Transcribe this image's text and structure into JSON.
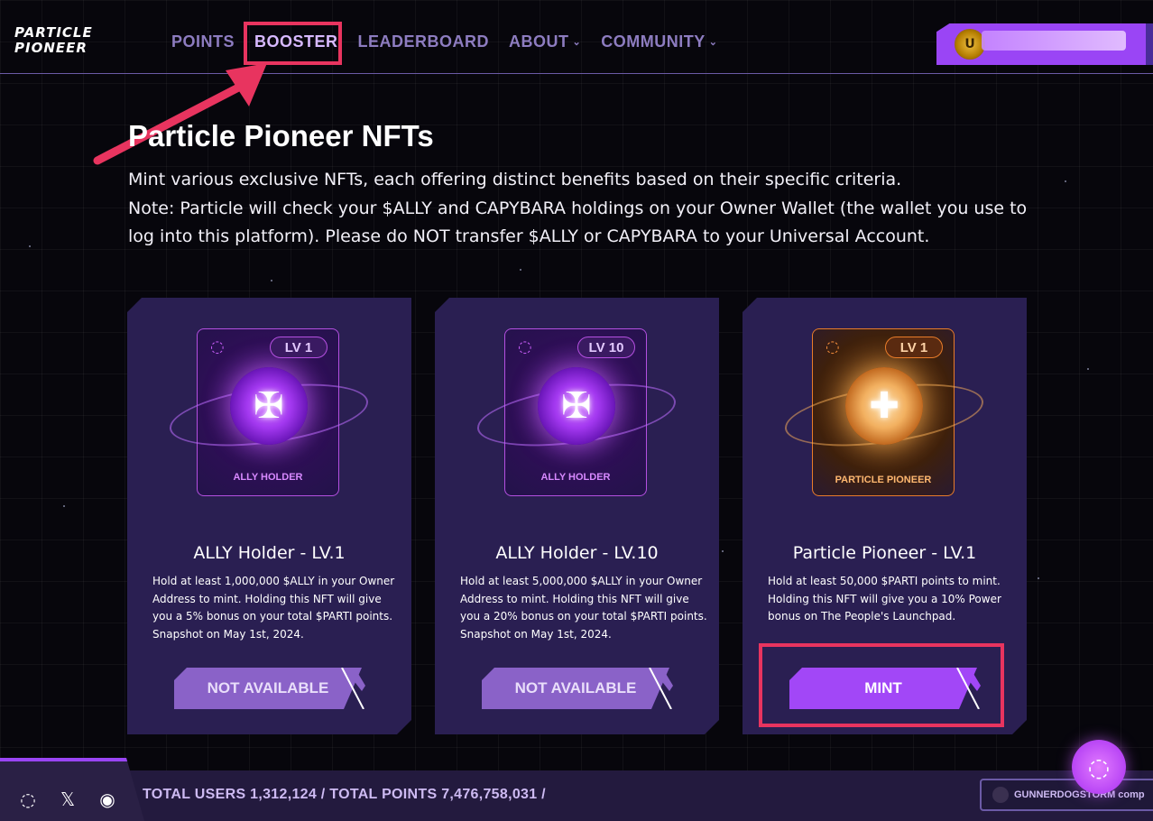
{
  "brand": {
    "line1": "PARTICLE",
    "line2": "PIONEER"
  },
  "nav": {
    "items": [
      {
        "label": "POINTS",
        "dropdown": false
      },
      {
        "label": "BOOSTER",
        "dropdown": false,
        "active": true
      },
      {
        "label": "LEADERBOARD",
        "dropdown": false
      },
      {
        "label": "ABOUT",
        "dropdown": true
      },
      {
        "label": "COMMUNITY",
        "dropdown": true
      }
    ]
  },
  "user_badge": {
    "coin_letter": "U"
  },
  "page": {
    "title": "Particle Pioneer NFTs",
    "line1": "Mint various exclusive NFTs, each offering distinct benefits based on their specific criteria.",
    "line2": "Note: Particle will check your $ALLY and CAPYBARA holdings on your Owner Wallet (the wallet you use to log into this platform). Please do NOT transfer $ALLY or CAPYBARA to your Universal Account."
  },
  "cards": [
    {
      "level_pill": "LV 1",
      "nft_label": "ALLY HOLDER",
      "title": "ALLY Holder - LV.1",
      "description": "Hold at least 1,000,000 $ALLY in your Owner Address to mint. Holding this NFT will give you a 5% bonus on your total $PARTI points. Snapshot on May 1st, 2024.",
      "button": "NOT AVAILABLE",
      "theme": "purple"
    },
    {
      "level_pill": "LV 10",
      "nft_label": "ALLY HOLDER",
      "title": "ALLY Holder - LV.10",
      "description": "Hold at least 5,000,000 $ALLY in your Owner Address to mint. Holding this NFT will give you a 20% bonus on your total $PARTI points. Snapshot on May 1st, 2024.",
      "button": "NOT AVAILABLE",
      "theme": "purple"
    },
    {
      "level_pill": "LV 1",
      "nft_label": "PARTICLE PIONEER",
      "title": "Particle Pioneer - LV.1",
      "description": "Hold at least 50,000 $PARTI points to mint. Holding this NFT will give you a 10% Power bonus on The People's Launchpad.",
      "button": "MINT",
      "theme": "orange"
    }
  ],
  "footer": {
    "stats": "TOTAL USERS 1,312,124 / TOTAL POINTS 7,476,758,031 /",
    "user": "GUNNERDOGSTORM comp"
  },
  "colors": {
    "accent": "#a247f7",
    "highlight": "#e8345f",
    "card_bg": "#2a1f52"
  }
}
